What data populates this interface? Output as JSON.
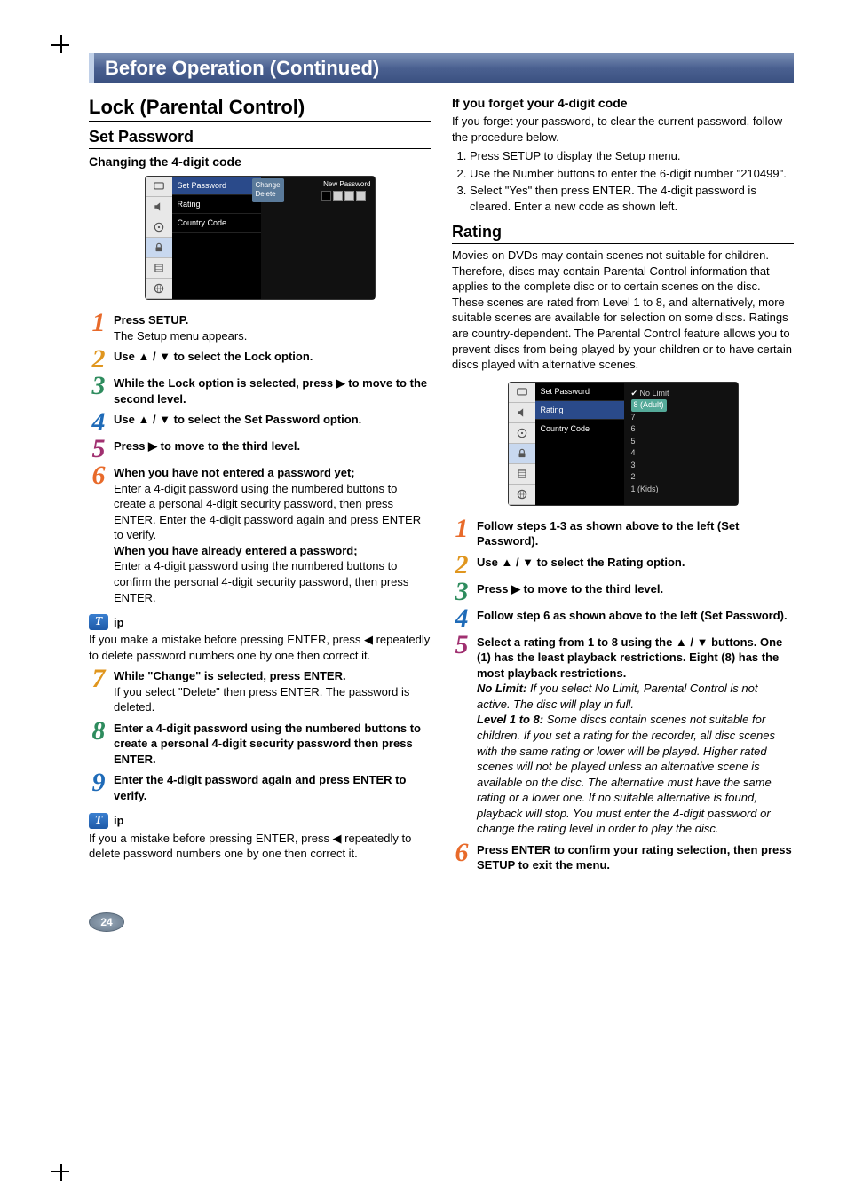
{
  "section_title": "Before Operation (Continued)",
  "left": {
    "h1": "Lock (Parental Control)",
    "h2": "Set Password",
    "h3": "Changing the 4-digit code",
    "osd": {
      "items": [
        "Set Password",
        "Rating",
        "Country Code"
      ],
      "popup_line1": "Change",
      "popup_line2": "Delete",
      "pw_label": "New Password"
    },
    "steps": [
      {
        "n": "1",
        "cls": "n1",
        "bold": "Press SETUP.",
        "text": "The Setup menu appears."
      },
      {
        "n": "2",
        "cls": "n2",
        "bold": "Use ▲ / ▼ to select the Lock option.",
        "text": ""
      },
      {
        "n": "3",
        "cls": "n3",
        "bold": "While the Lock option is selected, press ▶ to move to the second level.",
        "text": ""
      },
      {
        "n": "4",
        "cls": "n4",
        "bold": "Use ▲ / ▼ to select the Set Password option.",
        "text": ""
      },
      {
        "n": "5",
        "cls": "n5",
        "bold": "Press ▶ to move to the third level.",
        "text": ""
      },
      {
        "n": "6",
        "cls": "n6",
        "bold": "When you have not entered a password yet;",
        "text": "Enter a 4-digit password using the numbered buttons to create a personal 4-digit security password, then press ENTER. Enter the 4-digit password again and press ENTER to verify.",
        "bold2": "When you have already entered a password;",
        "text2": "Enter a 4-digit password using the numbered buttons to confirm the personal 4-digit security password, then press ENTER."
      }
    ],
    "tip1_label": "ip",
    "tip1_text": "If you make a mistake before pressing ENTER, press ◀ repeatedly to delete password numbers one by one then correct it.",
    "steps2": [
      {
        "n": "7",
        "cls": "n2",
        "bold": "While \"Change\" is selected, press ENTER.",
        "text": "If you select \"Delete\" then press ENTER. The password is deleted."
      },
      {
        "n": "8",
        "cls": "n3",
        "bold": "Enter a 4-digit password using the numbered buttons to create a personal 4-digit security password then press ENTER.",
        "text": ""
      },
      {
        "n": "9",
        "cls": "n4",
        "bold": "Enter the 4-digit password again and press ENTER to verify.",
        "text": ""
      }
    ],
    "tip2_label": "ip",
    "tip2_text": "If you a mistake before pressing ENTER, press ◀ repeatedly to delete password numbers one by one then correct it."
  },
  "right": {
    "forget_h": "If you forget your 4-digit code",
    "forget_p": "If you forget your password, to clear the current password, follow the procedure below.",
    "forget_list": [
      "Press SETUP to display the Setup menu.",
      "Use the Number buttons to enter the 6-digit number \"210499\".",
      "Select \"Yes\" then press ENTER. The 4-digit password is cleared. Enter a new code as shown left."
    ],
    "h2_rating": "Rating",
    "rating_para": "Movies on DVDs may contain scenes not suitable for children. Therefore, discs may contain Parental Control information that applies to the complete disc or to certain scenes on the disc. These scenes are rated from Level 1 to 8, and alternatively, more suitable scenes are available for selection on some discs. Ratings are country-dependent. The Parental Control feature allows you to prevent discs from being played by your children or to have certain discs played with alternative scenes.",
    "osd2": {
      "items": [
        "Set Password",
        "Rating",
        "Country Code"
      ],
      "ratings": [
        "No Limit",
        "8 (Adult)",
        "7",
        "6",
        "5",
        "4",
        "3",
        "2",
        "1 (Kids)"
      ]
    },
    "steps": [
      {
        "n": "1",
        "cls": "n1",
        "bold": "Follow steps 1-3 as shown above to the left (Set Password).",
        "text": ""
      },
      {
        "n": "2",
        "cls": "n2",
        "bold": "Use ▲ / ▼ to select the Rating option.",
        "text": ""
      },
      {
        "n": "3",
        "cls": "n3",
        "bold": "Press ▶ to move to the third level.",
        "text": ""
      },
      {
        "n": "4",
        "cls": "n4",
        "bold": "Follow step 6 as shown above to the left (Set Password).",
        "text": ""
      },
      {
        "n": "5",
        "cls": "n5",
        "bold": "Select a rating from 1 to 8 using the ▲ / ▼ buttons. One (1) has the least playback restrictions. Eight (8) has the most playback restrictions.",
        "nolimit_b": "No Limit:",
        "nolimit_t": " If you select No Limit, Parental Control is not active. The disc will play in full.",
        "level_b": "Level 1 to 8:",
        "level_t": " Some discs contain scenes not suitable for children. If you set a rating for the recorder, all disc scenes with the same rating or lower will be played. Higher rated scenes will not be played unless an alternative scene is available on the disc. The alternative must have the same rating or a lower one. If no suitable alternative is found, playback will stop. You must enter the 4-digit password or change the rating level in order to play the disc."
      },
      {
        "n": "6",
        "cls": "n1",
        "bold": "Press ENTER to confirm your rating selection, then press SETUP to exit the menu.",
        "text": ""
      }
    ]
  },
  "page_number": "24"
}
